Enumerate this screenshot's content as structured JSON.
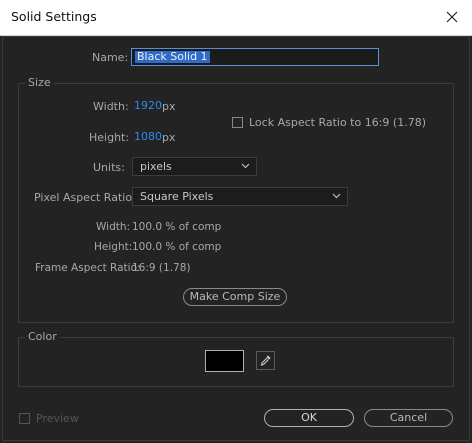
{
  "window": {
    "title": "Solid Settings"
  },
  "name_field": {
    "label": "Name:",
    "value": "Black Solid 1"
  },
  "size": {
    "group_label": "Size",
    "width_label": "Width:",
    "width_value": "1920",
    "width_unit": "px",
    "height_label": "Height:",
    "height_value": "1080",
    "height_unit": "px",
    "lock_label": "Lock Aspect Ratio to 16:9 (1.78)",
    "lock_checked": false,
    "units_label": "Units:",
    "units_value": "pixels",
    "par_label": "Pixel Aspect Ratio:",
    "par_value": "Square Pixels",
    "pct_width_label": "Width:",
    "pct_width_value": "100.0 % of comp",
    "pct_height_label": "Height:",
    "pct_height_value": "100.0 % of comp",
    "far_label": "Frame Aspect Ratio:",
    "far_value": "16:9 (1.78)",
    "make_comp_size_label": "Make Comp Size"
  },
  "color": {
    "group_label": "Color",
    "swatch_hex": "#000000"
  },
  "footer": {
    "preview_label": "Preview",
    "preview_checked": false,
    "ok_label": "OK",
    "cancel_label": "Cancel"
  },
  "theme": {
    "accent_blue": "#2d8ceb",
    "selection_blue": "#2f6bc9",
    "background": "#232323"
  }
}
